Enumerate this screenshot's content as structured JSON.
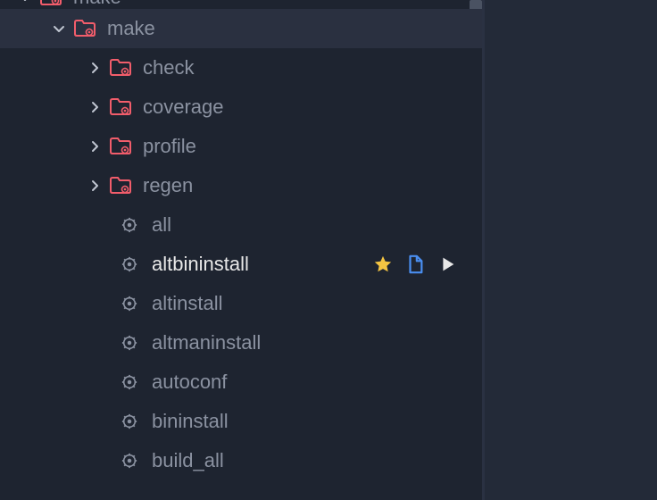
{
  "tree": {
    "root": {
      "label": "make"
    },
    "level1": {
      "label": "make"
    },
    "folders": [
      {
        "label": "check"
      },
      {
        "label": "coverage"
      },
      {
        "label": "profile"
      },
      {
        "label": "regen"
      }
    ],
    "targets": [
      {
        "label": "all"
      },
      {
        "label": "altbininstall",
        "hovered": true
      },
      {
        "label": "altinstall"
      },
      {
        "label": "altmaninstall"
      },
      {
        "label": "autoconf"
      },
      {
        "label": "bininstall"
      },
      {
        "label": "build_all"
      }
    ]
  },
  "colors": {
    "folder": "#f25d6b",
    "gear": "#8b92a1",
    "star": "#f5c542",
    "doc": "#4a8ef0",
    "play": "#e8e8e8",
    "chevron": "#c0c6d1"
  }
}
